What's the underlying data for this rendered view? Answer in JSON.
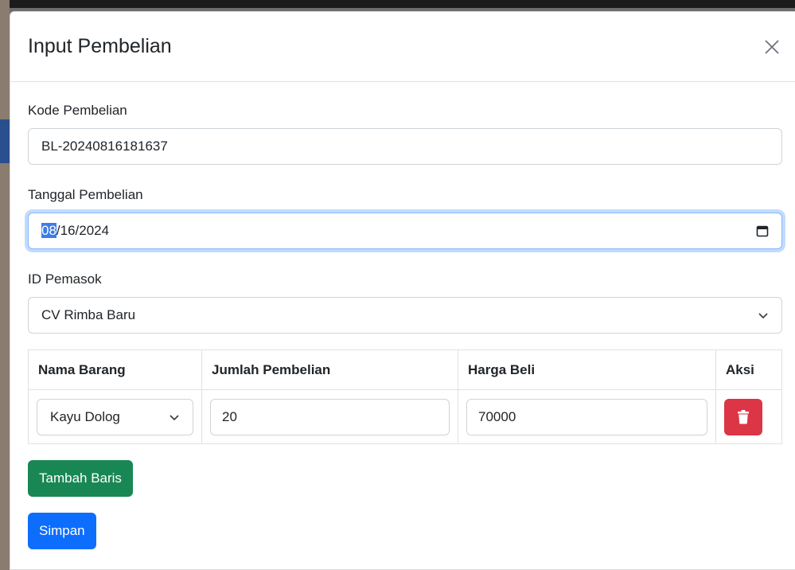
{
  "modal": {
    "title": "Input Pembelian",
    "close_icon": "close-icon"
  },
  "form": {
    "kode_label": "Kode Pembelian",
    "kode_value": "BL-20240816181637",
    "tanggal_label": "Tanggal Pembelian",
    "tanggal_month": "08",
    "tanggal_rest": "/16/2024",
    "pemasok_label": "ID Pemasok",
    "pemasok_value": "CV Rimba Baru"
  },
  "table": {
    "headers": [
      "Nama Barang",
      "Jumlah Pembelian",
      "Harga Beli",
      "Aksi"
    ],
    "rows": [
      {
        "nama_barang": "Kayu Dolog",
        "jumlah": "20",
        "harga": "70000"
      }
    ]
  },
  "buttons": {
    "tambah": "Tambah Baris",
    "simpan": "Simpan"
  },
  "colors": {
    "primary": "#0d6efd",
    "success": "#198754",
    "danger": "#dc3545"
  }
}
